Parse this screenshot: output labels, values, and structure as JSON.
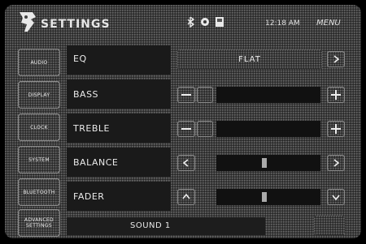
{
  "header": {
    "title": "SETTINGS",
    "time": "12:18 AM",
    "menu_label": "MENU",
    "status_icons": [
      "bluetooth-icon",
      "gear-icon",
      "sd-card-icon"
    ]
  },
  "sidebar": {
    "items": [
      {
        "label": "AUDIO"
      },
      {
        "label": "DISPLAY"
      },
      {
        "label": "CLOCK"
      },
      {
        "label": "SYSTEM"
      },
      {
        "label": "BLUETOOTH"
      },
      {
        "label": "ADVANCED SETTINGS"
      }
    ]
  },
  "settings": {
    "eq": {
      "label": "EQ",
      "value": "FLAT"
    },
    "bass": {
      "label": "BASS"
    },
    "treble": {
      "label": "TREBLE"
    },
    "balance": {
      "label": "BALANCE"
    },
    "fader": {
      "label": "FADER"
    }
  },
  "footer": {
    "sound_label": "SOUND 1"
  }
}
